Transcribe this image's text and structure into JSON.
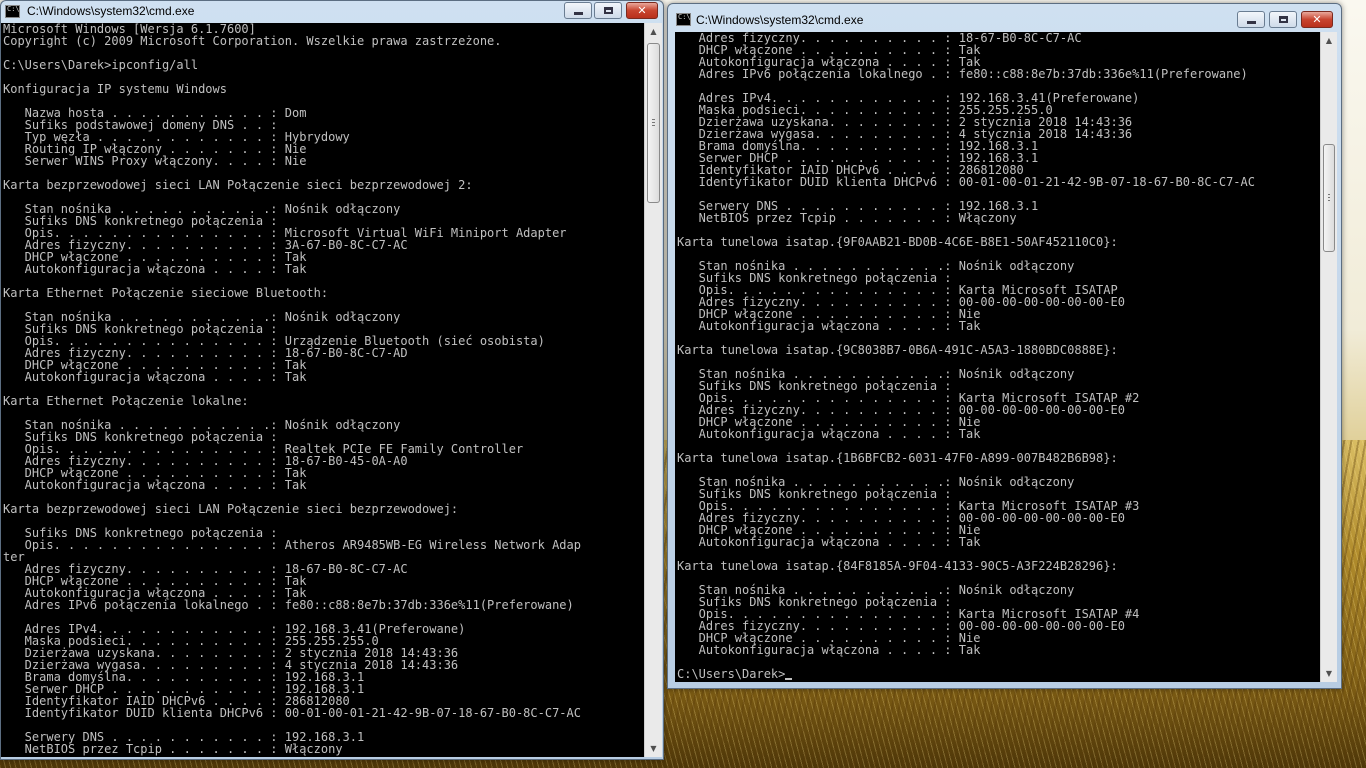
{
  "left_window": {
    "title": "C:\\Windows\\system32\\cmd.exe",
    "lines": [
      "Microsoft Windows [Wersja 6.1.7600]",
      "Copyright (c) 2009 Microsoft Corporation. Wszelkie prawa zastrzeżone.",
      "",
      "C:\\Users\\Darek>ipconfig/all",
      "",
      "Konfiguracja IP systemu Windows",
      "",
      "   Nazwa hosta . . . . . . . . . . . : Dom",
      "   Sufiks podstawowej domeny DNS . . :",
      "   Typ węzła . . . . . . . . . . . . : Hybrydowy",
      "   Routing IP włączony . . . . . . . : Nie",
      "   Serwer WINS Proxy włączony. . . . : Nie",
      "",
      "Karta bezprzewodowej sieci LAN Połączenie sieci bezprzewodowej 2:",
      "",
      "   Stan nośnika . . . . . . . . . . .: Nośnik odłączony",
      "   Sufiks DNS konkretnego połączenia :",
      "   Opis. . . . . . . . . . . . . . . : Microsoft Virtual WiFi Miniport Adapter",
      "   Adres fizyczny. . . . . . . . . . : 3A-67-B0-8C-C7-AC",
      "   DHCP włączone . . . . . . . . . . : Tak",
      "   Autokonfiguracja włączona . . . . : Tak",
      "",
      "Karta Ethernet Połączenie sieciowe Bluetooth:",
      "",
      "   Stan nośnika . . . . . . . . . . .: Nośnik odłączony",
      "   Sufiks DNS konkretnego połączenia :",
      "   Opis. . . . . . . . . . . . . . . : Urządzenie Bluetooth (sieć osobista)",
      "   Adres fizyczny. . . . . . . . . . : 18-67-B0-8C-C7-AD",
      "   DHCP włączone . . . . . . . . . . : Tak",
      "   Autokonfiguracja włączona . . . . : Tak",
      "",
      "Karta Ethernet Połączenie lokalne:",
      "",
      "   Stan nośnika . . . . . . . . . . .: Nośnik odłączony",
      "   Sufiks DNS konkretnego połączenia :",
      "   Opis. . . . . . . . . . . . . . . : Realtek PCIe FE Family Controller",
      "   Adres fizyczny. . . . . . . . . . : 18-67-B0-45-0A-A0",
      "   DHCP włączone . . . . . . . . . . : Tak",
      "   Autokonfiguracja włączona . . . . : Tak",
      "",
      "Karta bezprzewodowej sieci LAN Połączenie sieci bezprzewodowej:",
      "",
      "   Sufiks DNS konkretnego połączenia :",
      "   Opis. . . . . . . . . . . . . . . : Atheros AR9485WB-EG Wireless Network Adap",
      "ter",
      "   Adres fizyczny. . . . . . . . . . : 18-67-B0-8C-C7-AC",
      "   DHCP włączone . . . . . . . . . . : Tak",
      "   Autokonfiguracja włączona . . . . : Tak",
      "   Adres IPv6 połączenia lokalnego . : fe80::c88:8e7b:37db:336e%11(Preferowane)",
      "",
      "   Adres IPv4. . . . . . . . . . . . : 192.168.3.41(Preferowane)",
      "   Maska podsieci. . . . . . . . . . : 255.255.255.0",
      "   Dzierżawa uzyskana. . . . . . . . : 2 stycznia 2018 14:43:36",
      "   Dzierżawa wygasa. . . . . . . . . : 4 stycznia 2018 14:43:36",
      "   Brama domyślna. . . . . . . . . . : 192.168.3.1",
      "   Serwer DHCP . . . . . . . . . . . : 192.168.3.1",
      "   Identyfikator IAID DHCPv6 . . . . : 286812080",
      "   Identyfikator DUID klienta DHCPv6 : 00-01-00-01-21-42-9B-07-18-67-B0-8C-C7-AC",
      "",
      "   Serwery DNS . . . . . . . . . . . : 192.168.3.1",
      "   NetBIOS przez Tcpip . . . . . . . : Włączony"
    ]
  },
  "right_window": {
    "title": "C:\\Windows\\system32\\cmd.exe",
    "lines": [
      "   Adres fizyczny. . . . . . . . . . : 18-67-B0-8C-C7-AC",
      "   DHCP włączone . . . . . . . . . . : Tak",
      "   Autokonfiguracja włączona . . . . : Tak",
      "   Adres IPv6 połączenia lokalnego . : fe80::c88:8e7b:37db:336e%11(Preferowane)",
      "",
      "   Adres IPv4. . . . . . . . . . . . : 192.168.3.41(Preferowane)",
      "   Maska podsieci. . . . . . . . . . : 255.255.255.0",
      "   Dzierżawa uzyskana. . . . . . . . : 2 stycznia 2018 14:43:36",
      "   Dzierżawa wygasa. . . . . . . . . : 4 stycznia 2018 14:43:36",
      "   Brama domyślna. . . . . . . . . . : 192.168.3.1",
      "   Serwer DHCP . . . . . . . . . . . : 192.168.3.1",
      "   Identyfikator IAID DHCPv6 . . . . : 286812080",
      "   Identyfikator DUID klienta DHCPv6 : 00-01-00-01-21-42-9B-07-18-67-B0-8C-C7-AC",
      "",
      "   Serwery DNS . . . . . . . . . . . : 192.168.3.1",
      "   NetBIOS przez Tcpip . . . . . . . : Włączony",
      "",
      "Karta tunelowa isatap.{9F0AAB21-BD0B-4C6E-B8E1-50AF452110C0}:",
      "",
      "   Stan nośnika . . . . . . . . . . .: Nośnik odłączony",
      "   Sufiks DNS konkretnego połączenia :",
      "   Opis. . . . . . . . . . . . . . . : Karta Microsoft ISATAP",
      "   Adres fizyczny. . . . . . . . . . : 00-00-00-00-00-00-00-E0",
      "   DHCP włączone . . . . . . . . . . : Nie",
      "   Autokonfiguracja włączona . . . . : Tak",
      "",
      "Karta tunelowa isatap.{9C8038B7-0B6A-491C-A5A3-1880BDC0888E}:",
      "",
      "   Stan nośnika . . . . . . . . . . .: Nośnik odłączony",
      "   Sufiks DNS konkretnego połączenia :",
      "   Opis. . . . . . . . . . . . . . . : Karta Microsoft ISATAP #2",
      "   Adres fizyczny. . . . . . . . . . : 00-00-00-00-00-00-00-E0",
      "   DHCP włączone . . . . . . . . . . : Nie",
      "   Autokonfiguracja włączona . . . . : Tak",
      "",
      "Karta tunelowa isatap.{1B6BFCB2-6031-47F0-A899-007B482B6B98}:",
      "",
      "   Stan nośnika . . . . . . . . . . .: Nośnik odłączony",
      "   Sufiks DNS konkretnego połączenia :",
      "   Opis. . . . . . . . . . . . . . . : Karta Microsoft ISATAP #3",
      "   Adres fizyczny. . . . . . . . . . : 00-00-00-00-00-00-00-E0",
      "   DHCP włączone . . . . . . . . . . : Nie",
      "   Autokonfiguracja włączona . . . . : Tak",
      "",
      "Karta tunelowa isatap.{84F8185A-9F04-4133-90C5-A3F224B28296}:",
      "",
      "   Stan nośnika . . . . . . . . . . .: Nośnik odłączony",
      "   Sufiks DNS konkretnego połączenia :",
      "   Opis. . . . . . . . . . . . . . . : Karta Microsoft ISATAP #4",
      "   Adres fizyczny. . . . . . . . . . : 00-00-00-00-00-00-00-E0",
      "   DHCP włączone . . . . . . . . . . : Nie",
      "   Autokonfiguracja włączona . . . . : Tak",
      "",
      "C:\\Users\\Darek>"
    ]
  },
  "icons": {
    "minimize": "minimize-icon",
    "maximize": "maximize-icon",
    "close": "close-icon",
    "close_glyph": "✕",
    "scroll_up": "▲",
    "scroll_down": "▼"
  },
  "colors": {
    "console_bg": "#000000",
    "console_fg": "#c0c0c0",
    "close_button": "#c8442f"
  }
}
